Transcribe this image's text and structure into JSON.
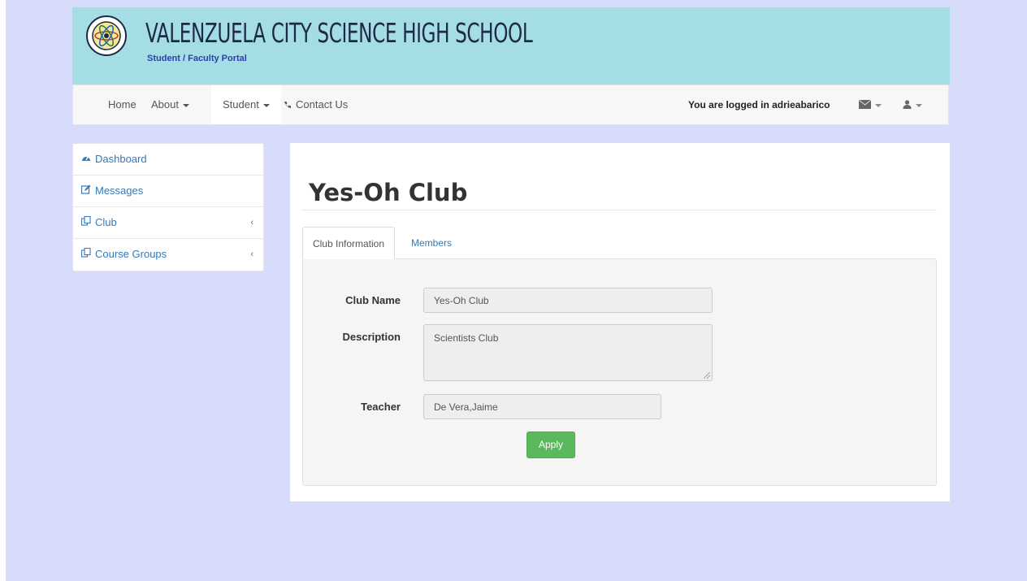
{
  "header": {
    "school_name": "VALENZUELA CITY SCIENCE HIGH SCHOOL",
    "portal_name": "Student / Faculty Portal",
    "logo_icon": "school-seal-icon"
  },
  "navbar": {
    "items": [
      {
        "label": "Home"
      },
      {
        "label": "About"
      },
      {
        "label": "Student"
      },
      {
        "label": "Contact Us",
        "icon": "phone-icon"
      }
    ],
    "logged_in_text": "You are logged in adrieabarico",
    "envelope_icon": "envelope-icon",
    "user_icon": "user-icon"
  },
  "sidebar": {
    "items": [
      {
        "label": "Dashboard",
        "icon": "dashboard-icon"
      },
      {
        "label": "Messages",
        "icon": "edit-icon"
      },
      {
        "label": "Club",
        "icon": "copy-icon"
      },
      {
        "label": "Course Groups",
        "icon": "copy-icon"
      }
    ]
  },
  "main": {
    "title": "Yes-Oh Club",
    "tabs": [
      {
        "label": "Club Information"
      },
      {
        "label": "Members"
      }
    ],
    "form": {
      "club_name_label": "Club Name",
      "club_name_value": "Yes-Oh Club",
      "description_label": "Description",
      "description_value": "Scientists Club",
      "teacher_label": "Teacher",
      "teacher_value": "De Vera,Jaime",
      "apply_label": "Apply"
    }
  },
  "colors": {
    "page_bg": "#d8dcfb",
    "banner_bg": "#a5dde5",
    "link": "#337ab7",
    "apply_button": "#5cb85c"
  }
}
